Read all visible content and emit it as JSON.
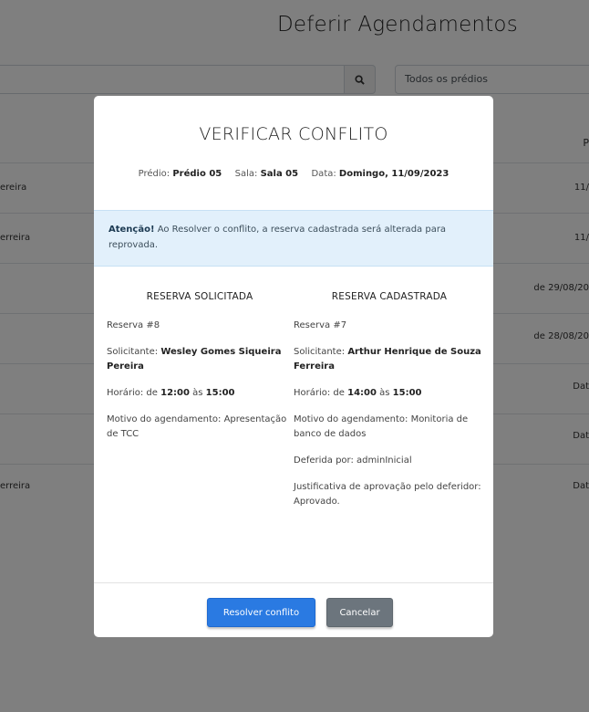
{
  "page": {
    "title": "Deferir Agendamentos",
    "building_filter": "Todos os prédios",
    "rows": [
      {
        "left": "ereira",
        "right": "11/"
      },
      {
        "left": "erreira",
        "right": "11/"
      },
      {
        "left": "",
        "right": "de 29/08/20"
      },
      {
        "left": "",
        "right": "de 28/08/20"
      },
      {
        "left": "",
        "right": "Dat"
      },
      {
        "left": "",
        "right": "Dat"
      },
      {
        "left": "erreira",
        "right": "Dat"
      }
    ],
    "header_right": "P"
  },
  "modal": {
    "title": "VERIFICAR CONFLITO",
    "info": {
      "building_label": "Prédio:",
      "building_value": "Prédio 05",
      "room_label": "Sala:",
      "room_value": "Sala 05",
      "date_label": "Data:",
      "date_value": "Domingo, 11/09/2023"
    },
    "alert": {
      "strong": "Atenção!",
      "text": " Ao Resolver o conflito, a reserva cadastrada será alterada para reprovada."
    },
    "requested": {
      "heading": "RESERVA SOLICITADA",
      "reservation": "Reserva #8",
      "requester_label": "Solicitante: ",
      "requester_name": "Wesley Gomes Siqueira Pereira",
      "time_label": "Horário: de ",
      "time_start": "12:00",
      "time_mid": " às ",
      "time_end": "15:00",
      "reason": "Motivo do agendamento: Apresentação de TCC"
    },
    "registered": {
      "heading": "RESERVA CADASTRADA",
      "reservation": "Reserva #7",
      "requester_label": "Solicitante: ",
      "requester_name": "Arthur Henrique de Souza Ferreira",
      "time_label": "Horário: de ",
      "time_start": "14:00",
      "time_mid": " às ",
      "time_end": "15:00",
      "reason": "Motivo do agendamento: Monitoria de banco de dados",
      "approved_by": "Deferida por: adminInicial",
      "justification": "Justificativa de aprovação pelo deferidor: Aprovado."
    },
    "buttons": {
      "resolve": "Resolver conflito",
      "cancel": "Cancelar"
    }
  }
}
